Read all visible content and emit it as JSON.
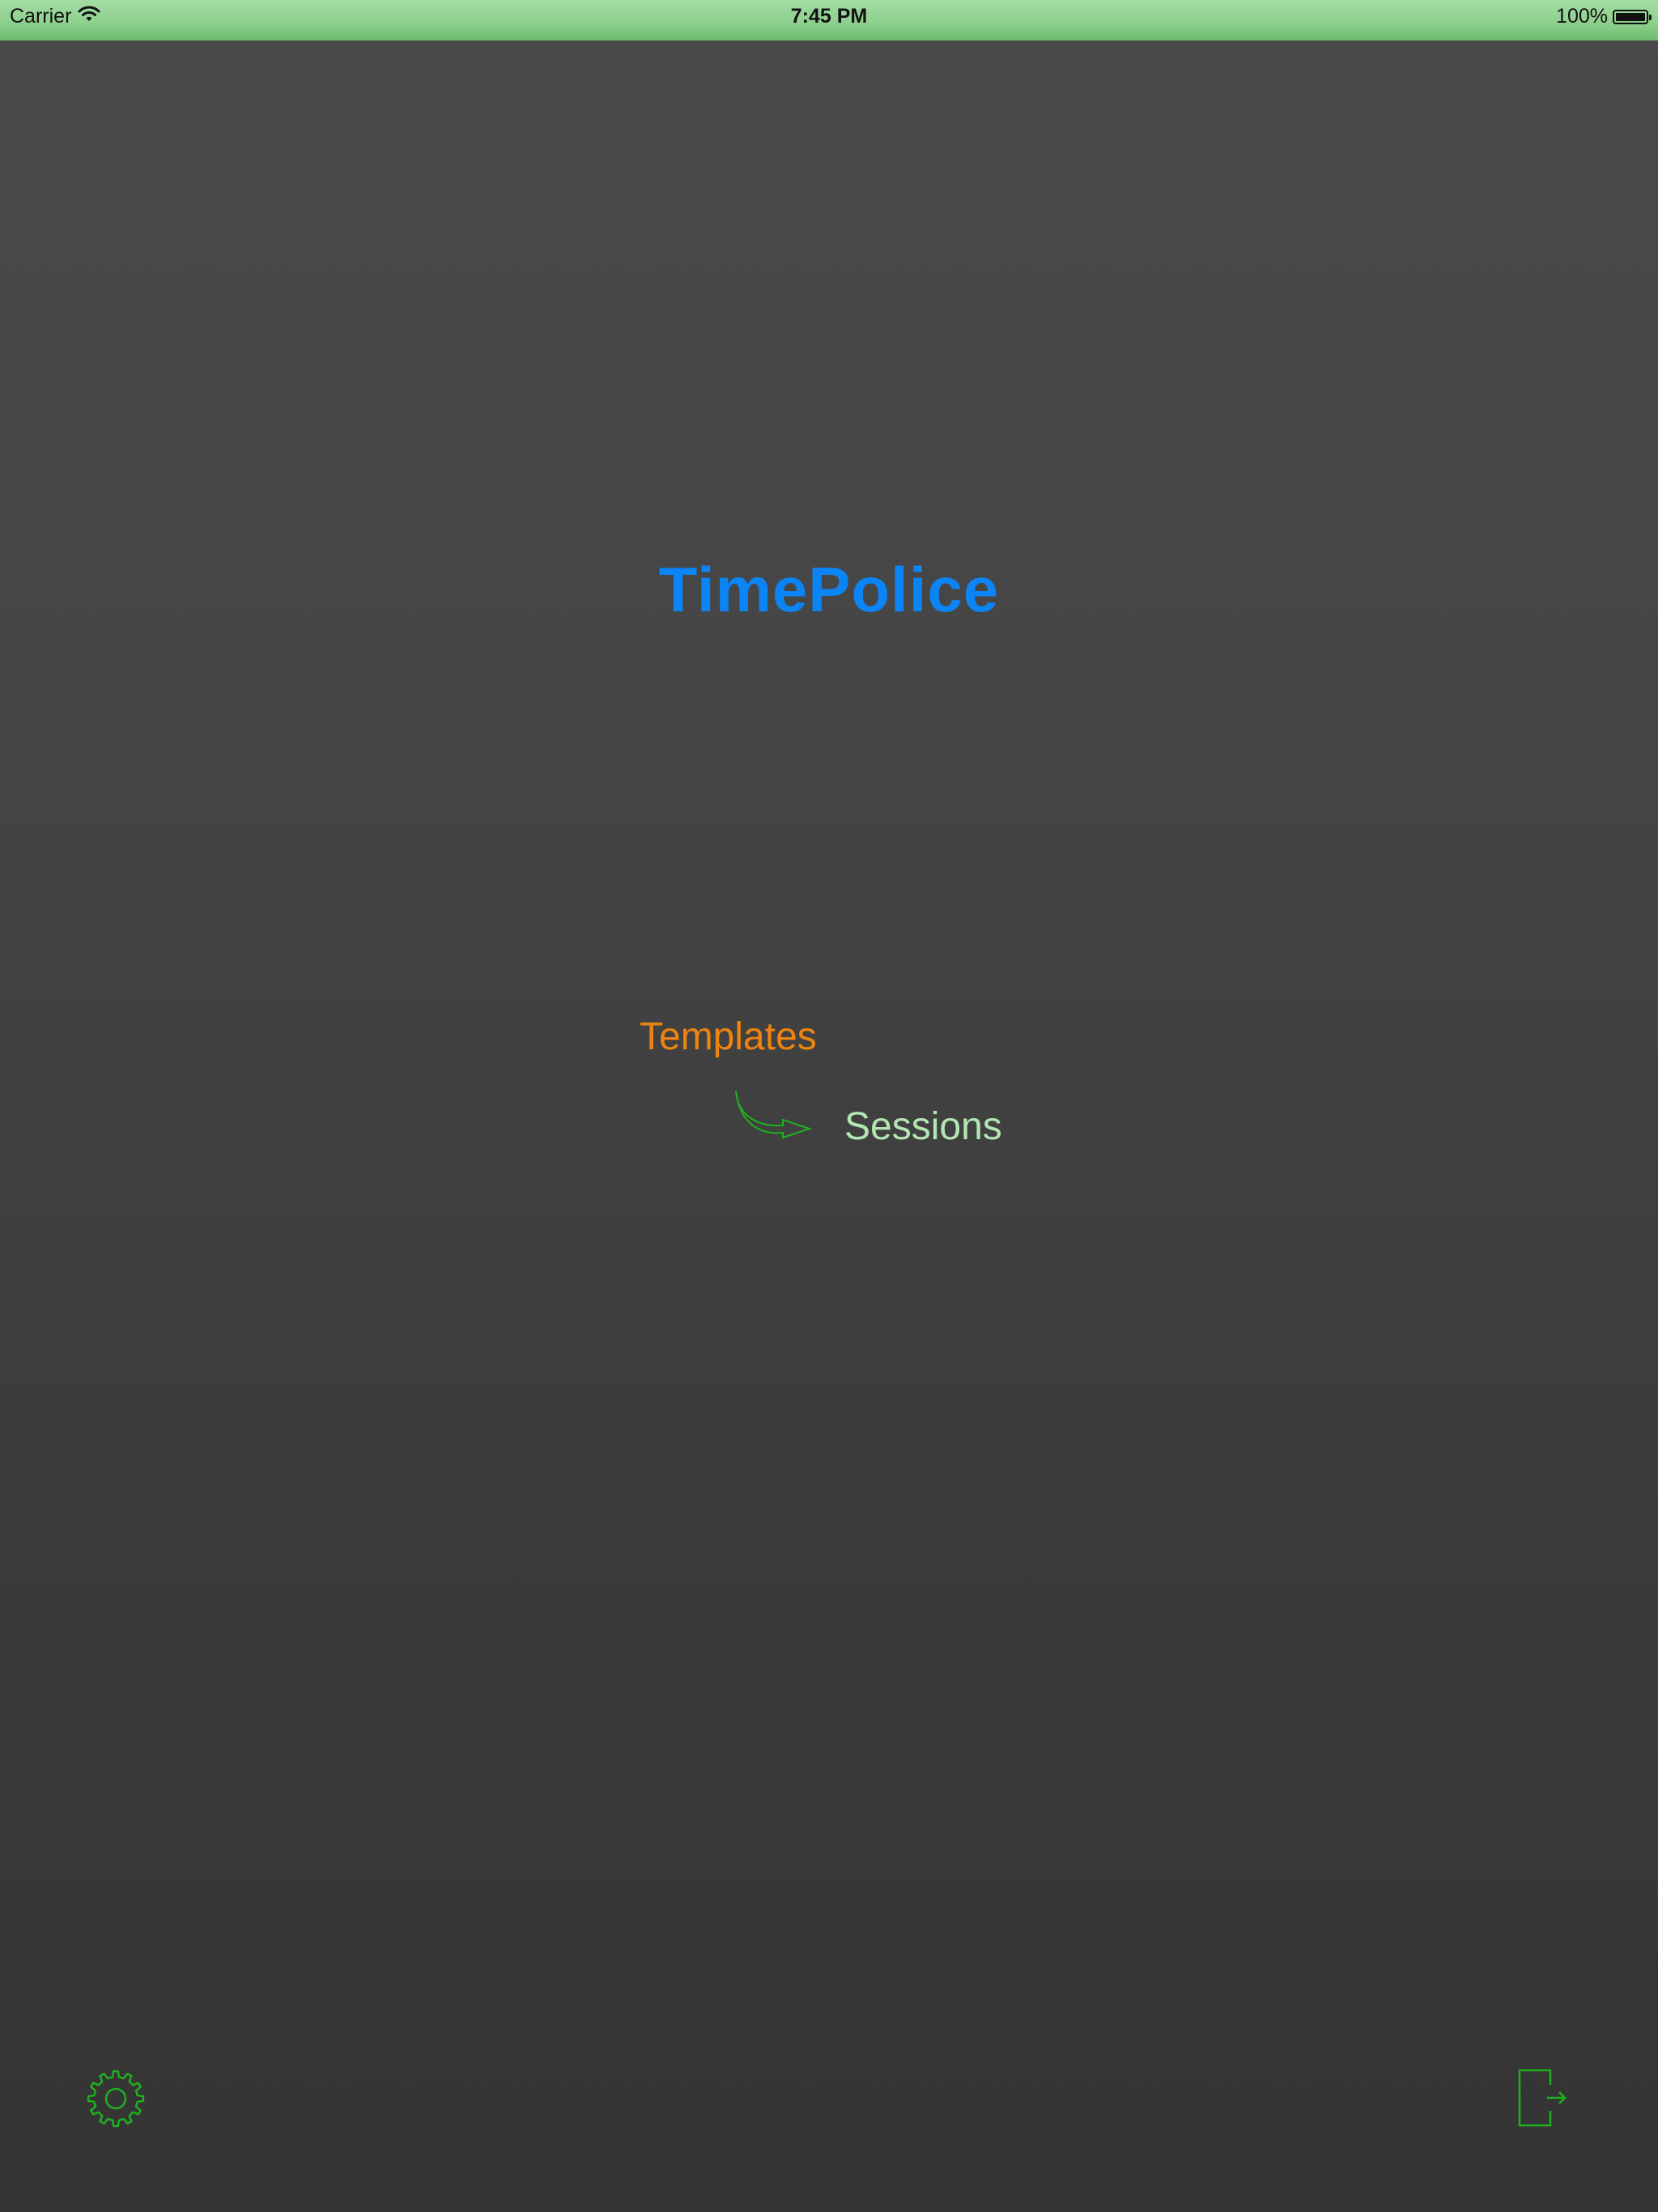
{
  "status_bar": {
    "carrier": "Carrier",
    "time": "7:45 PM",
    "battery": "100%",
    "battery_level": 1.0
  },
  "app": {
    "title": "TimePolice"
  },
  "menu": {
    "templates_label": "Templates",
    "sessions_label": "Sessions"
  },
  "icons": {
    "settings": "gear-icon",
    "logout": "exit-door-icon",
    "flow": "curved-arrow-icon",
    "wifi": "wifi-icon",
    "battery": "battery-icon"
  },
  "colors": {
    "status_bar": "#8fd08f",
    "title": "#0b84f5",
    "templates": "#ee8410",
    "sessions": "#b3e6b3",
    "icon_green": "#1fb01f",
    "background": "#424242"
  }
}
